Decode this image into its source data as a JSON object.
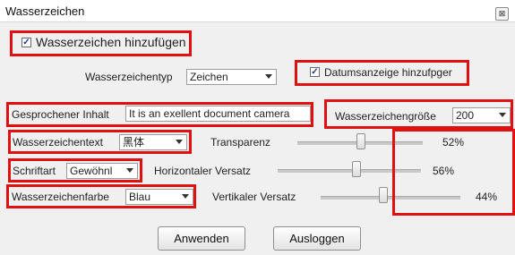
{
  "window": {
    "title": "Wasserzeichen",
    "close_glyph": "⊠"
  },
  "add_watermark": {
    "label": "Wasserzeichen hinzufügen",
    "checked": true
  },
  "watermark_type": {
    "label": "Wasserzeichentyp",
    "value": "Zeichen"
  },
  "date_display": {
    "label": "Datumsanzeige hinzufpger",
    "checked": true
  },
  "spoken_content": {
    "label": "Gesprochener Inhalt",
    "value": "It is an exellent document camera"
  },
  "watermark_size": {
    "label": "Wasserzeichengröße",
    "value": "200"
  },
  "watermark_text": {
    "label": "Wasserzeichentext",
    "value": "黑体"
  },
  "font_style": {
    "label": "Schriftart",
    "value": "Gewöhnl"
  },
  "watermark_color": {
    "label": "Wasserzeichenfarbe",
    "value": "Blau"
  },
  "transparency": {
    "label": "Transparenz",
    "value_text": "52%",
    "value": 52
  },
  "horizontal_offset": {
    "label": "Horizontaler Versatz",
    "value_text": "56%",
    "value": 56
  },
  "vertical_offset": {
    "label": "Vertikaler Versatz",
    "value_text": "44%",
    "value": 44
  },
  "buttons": {
    "apply": "Anwenden",
    "logout": "Ausloggen"
  },
  "colors": {
    "highlight": "#e01010",
    "panel": "#f0f0f0"
  },
  "icons": {
    "close": "close-icon",
    "dropdown": "chevron-down-icon",
    "checkbox": "checkmark-icon"
  }
}
